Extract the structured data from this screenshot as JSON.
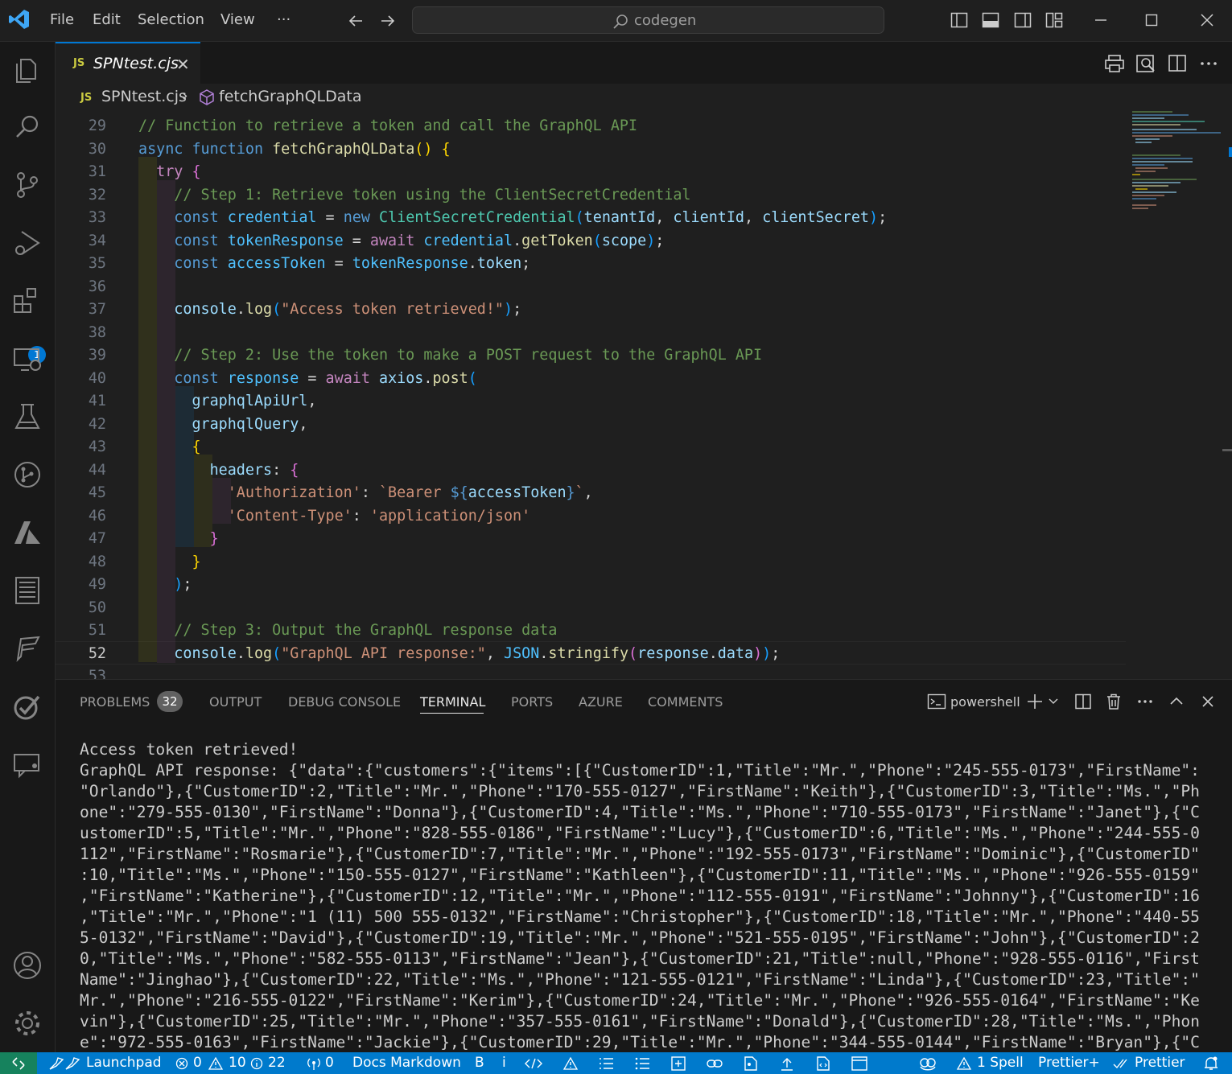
{
  "titlebar": {
    "menu": [
      "File",
      "Edit",
      "Selection",
      "View"
    ],
    "more": "···",
    "search": "codegen"
  },
  "activity_bar": {
    "items": [
      "explorer-icon",
      "search-icon",
      "source-control-icon",
      "run-debug-icon",
      "extensions-icon",
      "remote-explorer-icon",
      "testing-icon",
      "git-graph-icon",
      "azure-icon",
      "notebook-icon",
      "bookmark-icon",
      "todo-icon",
      "chat-icon",
      "account-icon",
      "settings-gear-icon"
    ],
    "extensions_badge": "1"
  },
  "editor": {
    "tab": {
      "icon": "JS",
      "name": "SPNtest.cjs",
      "close": "✕"
    },
    "breadcrumb": {
      "icon": "JS",
      "file": "SPNtest.cjs",
      "separator": "›",
      "symbol": "fetchGraphQLData"
    },
    "current_line": "52",
    "lines": [
      {
        "n": "29",
        "tokens": [
          [
            "com",
            "// Function to retrieve a token and call the GraphQL API"
          ]
        ]
      },
      {
        "n": "30",
        "tokens": [
          [
            "kw",
            "async"
          ],
          [
            "op",
            " "
          ],
          [
            "kw",
            "function"
          ],
          [
            "op",
            " "
          ],
          [
            "fn",
            "fetchGraphQLData"
          ],
          [
            "p1",
            "()"
          ],
          [
            "op",
            " "
          ],
          [
            "p1",
            "{"
          ]
        ]
      },
      {
        "n": "31",
        "tokens": [
          [
            "op",
            "  "
          ],
          [
            "ctl",
            "try"
          ],
          [
            "op",
            " "
          ],
          [
            "p2",
            "{"
          ]
        ]
      },
      {
        "n": "32",
        "tokens": [
          [
            "op",
            "    "
          ],
          [
            "com",
            "// Step 1: Retrieve token using the ClientSecretCredential"
          ]
        ]
      },
      {
        "n": "33",
        "tokens": [
          [
            "op",
            "    "
          ],
          [
            "kw",
            "const"
          ],
          [
            "op",
            " "
          ],
          [
            "const",
            "credential"
          ],
          [
            "op",
            " = "
          ],
          [
            "kw",
            "new"
          ],
          [
            "op",
            " "
          ],
          [
            "cls",
            "ClientSecretCredential"
          ],
          [
            "p3",
            "("
          ],
          [
            "var",
            "tenantId"
          ],
          [
            "op",
            ", "
          ],
          [
            "var",
            "clientId"
          ],
          [
            "op",
            ", "
          ],
          [
            "var",
            "clientSecret"
          ],
          [
            "p3",
            ")"
          ],
          [
            "op",
            ";"
          ]
        ]
      },
      {
        "n": "34",
        "tokens": [
          [
            "op",
            "    "
          ],
          [
            "kw",
            "const"
          ],
          [
            "op",
            " "
          ],
          [
            "const",
            "tokenResponse"
          ],
          [
            "op",
            " = "
          ],
          [
            "ctl",
            "await"
          ],
          [
            "op",
            " "
          ],
          [
            "const",
            "credential"
          ],
          [
            "op",
            "."
          ],
          [
            "fn",
            "getToken"
          ],
          [
            "p3",
            "("
          ],
          [
            "var",
            "scope"
          ],
          [
            "p3",
            ")"
          ],
          [
            "op",
            ";"
          ]
        ]
      },
      {
        "n": "35",
        "tokens": [
          [
            "op",
            "    "
          ],
          [
            "kw",
            "const"
          ],
          [
            "op",
            " "
          ],
          [
            "const",
            "accessToken"
          ],
          [
            "op",
            " = "
          ],
          [
            "const",
            "tokenResponse"
          ],
          [
            "op",
            "."
          ],
          [
            "var",
            "token"
          ],
          [
            "op",
            ";"
          ]
        ]
      },
      {
        "n": "36",
        "tokens": []
      },
      {
        "n": "37",
        "tokens": [
          [
            "op",
            "    "
          ],
          [
            "var",
            "console"
          ],
          [
            "op",
            "."
          ],
          [
            "fn",
            "log"
          ],
          [
            "p3",
            "("
          ],
          [
            "str",
            "\"Access token retrieved!\""
          ],
          [
            "p3",
            ")"
          ],
          [
            "op",
            ";"
          ]
        ]
      },
      {
        "n": "38",
        "tokens": []
      },
      {
        "n": "39",
        "tokens": [
          [
            "op",
            "    "
          ],
          [
            "com",
            "// Step 2: Use the token to make a POST request to the GraphQL API"
          ]
        ]
      },
      {
        "n": "40",
        "tokens": [
          [
            "op",
            "    "
          ],
          [
            "kw",
            "const"
          ],
          [
            "op",
            " "
          ],
          [
            "const",
            "response"
          ],
          [
            "op",
            " = "
          ],
          [
            "ctl",
            "await"
          ],
          [
            "op",
            " "
          ],
          [
            "var",
            "axios"
          ],
          [
            "op",
            "."
          ],
          [
            "fn",
            "post"
          ],
          [
            "p3",
            "("
          ]
        ]
      },
      {
        "n": "41",
        "tokens": [
          [
            "op",
            "      "
          ],
          [
            "var",
            "graphqlApiUrl"
          ],
          [
            "op",
            ","
          ]
        ]
      },
      {
        "n": "42",
        "tokens": [
          [
            "op",
            "      "
          ],
          [
            "var",
            "graphqlQuery"
          ],
          [
            "op",
            ","
          ]
        ]
      },
      {
        "n": "43",
        "tokens": [
          [
            "op",
            "      "
          ],
          [
            "p1",
            "{"
          ]
        ]
      },
      {
        "n": "44",
        "tokens": [
          [
            "op",
            "        "
          ],
          [
            "var",
            "headers"
          ],
          [
            "op",
            ": "
          ],
          [
            "p2",
            "{"
          ]
        ]
      },
      {
        "n": "45",
        "tokens": [
          [
            "op",
            "          "
          ],
          [
            "str",
            "'Authorization'"
          ],
          [
            "op",
            ": "
          ],
          [
            "str",
            "`Bearer "
          ],
          [
            "kw",
            "${"
          ],
          [
            "var",
            "accessToken"
          ],
          [
            "kw",
            "}"
          ],
          [
            "str",
            "`"
          ],
          [
            "op",
            ","
          ]
        ]
      },
      {
        "n": "46",
        "tokens": [
          [
            "op",
            "          "
          ],
          [
            "str",
            "'Content-Type'"
          ],
          [
            "op",
            ": "
          ],
          [
            "str",
            "'application/json'"
          ]
        ]
      },
      {
        "n": "47",
        "tokens": [
          [
            "op",
            "        "
          ],
          [
            "p2",
            "}"
          ]
        ]
      },
      {
        "n": "48",
        "tokens": [
          [
            "op",
            "      "
          ],
          [
            "p1",
            "}"
          ]
        ]
      },
      {
        "n": "49",
        "tokens": [
          [
            "op",
            "    "
          ],
          [
            "p3",
            ")"
          ],
          [
            "op",
            ";"
          ]
        ]
      },
      {
        "n": "50",
        "tokens": []
      },
      {
        "n": "51",
        "tokens": [
          [
            "op",
            "    "
          ],
          [
            "com",
            "// Step 3: Output the GraphQL response data"
          ]
        ]
      },
      {
        "n": "52",
        "tokens": [
          [
            "op",
            "    "
          ],
          [
            "var",
            "console"
          ],
          [
            "op",
            "."
          ],
          [
            "fn",
            "log"
          ],
          [
            "p3",
            "("
          ],
          [
            "str",
            "\"GraphQL API response:\""
          ],
          [
            "op",
            ", "
          ],
          [
            "const",
            "JSON"
          ],
          [
            "op",
            "."
          ],
          [
            "fn",
            "stringify"
          ],
          [
            "p2",
            "("
          ],
          [
            "var",
            "response"
          ],
          [
            "op",
            "."
          ],
          [
            "var",
            "data"
          ],
          [
            "p2",
            ")"
          ],
          [
            "p3",
            ")"
          ],
          [
            "op",
            ";"
          ]
        ]
      },
      {
        "n": "53",
        "tokens": []
      }
    ]
  },
  "panel": {
    "tabs": [
      {
        "label": "PROBLEMS",
        "badge": "32"
      },
      {
        "label": "OUTPUT"
      },
      {
        "label": "DEBUG CONSOLE"
      },
      {
        "label": "TERMINAL",
        "active": true
      },
      {
        "label": "PORTS"
      },
      {
        "label": "AZURE"
      },
      {
        "label": "COMMENTS"
      }
    ],
    "shell": "powershell",
    "terminal_lines": [
      "Access token retrieved!",
      "GraphQL API response: {\"data\":{\"customers\":{\"items\":[{\"CustomerID\":1,\"Title\":\"Mr.\",\"Phone\":\"245-555-0173\",\"FirstName\":",
      "\"Orlando\"},{\"CustomerID\":2,\"Title\":\"Mr.\",\"Phone\":\"170-555-0127\",\"FirstName\":\"Keith\"},{\"CustomerID\":3,\"Title\":\"Ms.\",\"Ph",
      "one\":\"279-555-0130\",\"FirstName\":\"Donna\"},{\"CustomerID\":4,\"Title\":\"Ms.\",\"Phone\":\"710-555-0173\",\"FirstName\":\"Janet\"},{\"C",
      "ustomerID\":5,\"Title\":\"Mr.\",\"Phone\":\"828-555-0186\",\"FirstName\":\"Lucy\"},{\"CustomerID\":6,\"Title\":\"Ms.\",\"Phone\":\"244-555-0",
      "112\",\"FirstName\":\"Rosmarie\"},{\"CustomerID\":7,\"Title\":\"Mr.\",\"Phone\":\"192-555-0173\",\"FirstName\":\"Dominic\"},{\"CustomerID\"",
      ":10,\"Title\":\"Ms.\",\"Phone\":\"150-555-0127\",\"FirstName\":\"Kathleen\"},{\"CustomerID\":11,\"Title\":\"Ms.\",\"Phone\":\"926-555-0159\"",
      ",\"FirstName\":\"Katherine\"},{\"CustomerID\":12,\"Title\":\"Mr.\",\"Phone\":\"112-555-0191\",\"FirstName\":\"Johnny\"},{\"CustomerID\":16",
      ",\"Title\":\"Mr.\",\"Phone\":\"1 (11) 500 555-0132\",\"FirstName\":\"Christopher\"},{\"CustomerID\":18,\"Title\":\"Mr.\",\"Phone\":\"440-55",
      "5-0132\",\"FirstName\":\"David\"},{\"CustomerID\":19,\"Title\":\"Mr.\",\"Phone\":\"521-555-0195\",\"FirstName\":\"John\"},{\"CustomerID\":2",
      "0,\"Title\":\"Ms.\",\"Phone\":\"582-555-0113\",\"FirstName\":\"Jean\"},{\"CustomerID\":21,\"Title\":null,\"Phone\":\"928-555-0116\",\"First",
      "Name\":\"Jinghao\"},{\"CustomerID\":22,\"Title\":\"Ms.\",\"Phone\":\"121-555-0121\",\"FirstName\":\"Linda\"},{\"CustomerID\":23,\"Title\":\"",
      "Mr.\",\"Phone\":\"216-555-0122\",\"FirstName\":\"Kerim\"},{\"CustomerID\":24,\"Title\":\"Mr.\",\"Phone\":\"926-555-0164\",\"FirstName\":\"Ke",
      "vin\"},{\"CustomerID\":25,\"Title\":\"Mr.\",\"Phone\":\"357-555-0161\",\"FirstName\":\"Donald\"},{\"CustomerID\":28,\"Title\":\"Ms.\",\"Phon",
      "e\":\"972-555-0163\",\"FirstName\":\"Jackie\"},{\"CustomerID\":29,\"Title\":\"Mr.\",\"Phone\":\"344-555-0144\",\"FirstName\":\"Bryan\"},{\"C"
    ]
  },
  "statusbar": {
    "launchpad": "Launchpad",
    "errors": "0",
    "warnings": "10",
    "infos": "22",
    "ports": "0",
    "docs_markdown": "Docs Markdown",
    "bold": "B",
    "italic": "i",
    "spell": "1 Spell",
    "prettier_plus": "Prettier+",
    "prettier": "Prettier"
  },
  "colors": {
    "accent": "#0078d4",
    "statusbar": "#007acc",
    "remote": "#16825d",
    "editor_bg": "#1f1f1f"
  }
}
